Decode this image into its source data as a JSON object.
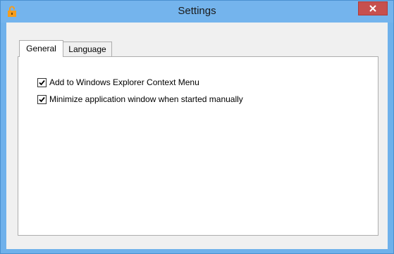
{
  "window": {
    "title": "Settings",
    "icon": "lock-icon",
    "close_icon": "close-icon"
  },
  "tabs": [
    {
      "label": "General",
      "active": true
    },
    {
      "label": "Language",
      "active": false
    }
  ],
  "general": {
    "options": [
      {
        "label": "Add to Windows Explorer Context Menu",
        "checked": true
      },
      {
        "label": "Minimize application window when started manually",
        "checked": true
      }
    ]
  },
  "colors": {
    "frame": "#74b4ed",
    "close_button": "#c7504e",
    "icon": "#f59d1e"
  }
}
